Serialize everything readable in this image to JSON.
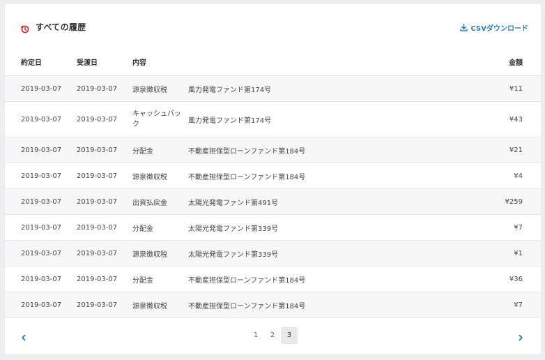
{
  "header": {
    "title": "すべての履歴",
    "csv_label": "CSVダウンロード",
    "title_icon": "clock-icon",
    "csv_icon": "download-icon",
    "accent_color": "#2a7fc1",
    "title_icon_color": "#d0262f"
  },
  "table": {
    "columns": {
      "contract_date": "約定日",
      "delivery_date": "受渡日",
      "type": "内容",
      "fund": "",
      "amount": "金額"
    },
    "rows": [
      {
        "contract_date": "2019-03-07",
        "delivery_date": "2019-03-07",
        "type": "源泉徴収税",
        "fund": "風力発電ファンド第174号",
        "amount": "¥11"
      },
      {
        "contract_date": "2019-03-07",
        "delivery_date": "2019-03-07",
        "type": "キャッシュバック",
        "fund": "風力発電ファンド第174号",
        "amount": "¥43"
      },
      {
        "contract_date": "2019-03-07",
        "delivery_date": "2019-03-07",
        "type": "分配金",
        "fund": "不動産担保型ローンファンド第184号",
        "amount": "¥21"
      },
      {
        "contract_date": "2019-03-07",
        "delivery_date": "2019-03-07",
        "type": "源泉徴収税",
        "fund": "不動産担保型ローンファンド第184号",
        "amount": "¥4"
      },
      {
        "contract_date": "2019-03-07",
        "delivery_date": "2019-03-07",
        "type": "出資払戻金",
        "fund": "太陽光発電ファンド第491号",
        "amount": "¥259"
      },
      {
        "contract_date": "2019-03-07",
        "delivery_date": "2019-03-07",
        "type": "分配金",
        "fund": "太陽光発電ファンド第339号",
        "amount": "¥7"
      },
      {
        "contract_date": "2019-03-07",
        "delivery_date": "2019-03-07",
        "type": "源泉徴収税",
        "fund": "太陽光発電ファンド第339号",
        "amount": "¥1"
      },
      {
        "contract_date": "2019-03-07",
        "delivery_date": "2019-03-07",
        "type": "分配金",
        "fund": "不動産担保型ローンファンド第184号",
        "amount": "¥36"
      },
      {
        "contract_date": "2019-03-07",
        "delivery_date": "2019-03-07",
        "type": "源泉徴収税",
        "fund": "不動産担保型ローンファンド第184号",
        "amount": "¥7"
      }
    ]
  },
  "pagination": {
    "prev_icon": "chevron-left-icon",
    "next_icon": "chevron-right-icon",
    "pages": [
      "1",
      "2",
      "3"
    ],
    "current_page": "3"
  }
}
